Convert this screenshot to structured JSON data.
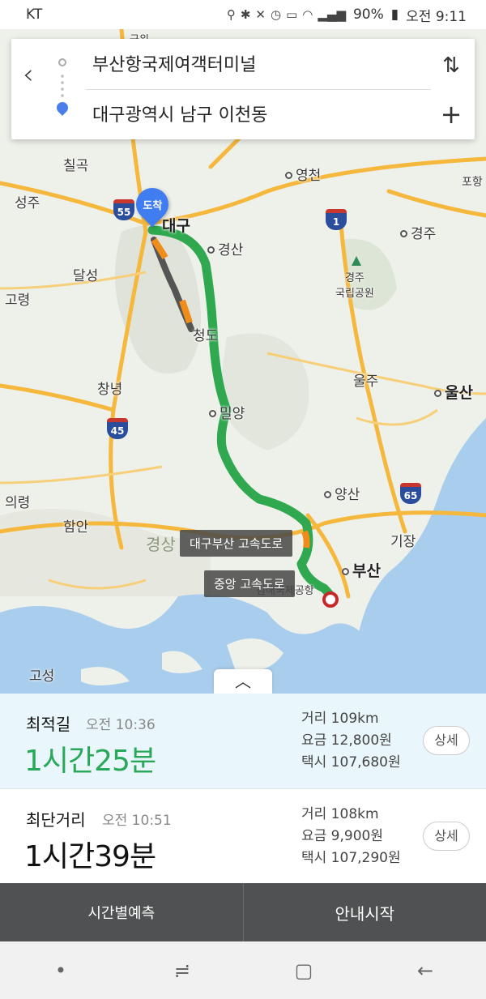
{
  "status_bar": {
    "carrier": "KT",
    "battery": "90%",
    "time": "오전 9:11"
  },
  "search": {
    "origin": "부산항국제여객터미널",
    "destination": "대구광역시 남구 이천동",
    "back_icon": "back-arrow-icon",
    "swap_icon": "swap-icon",
    "add_icon": "plus-icon"
  },
  "map": {
    "places": {
      "chilgok": "칠곡",
      "seongju": "성주",
      "daegu": "대구",
      "gyeongsan": "경산",
      "yeongcheon": "영천",
      "gyeongju": "경주",
      "gyeongju_park": "경주\n국립공원",
      "pohang": "포항",
      "dalseong": "달성",
      "goryeong": "고령",
      "cheongdo": "청도",
      "changnyeong": "창녕",
      "miryang": "밀양",
      "ulju": "울주",
      "ulsan": "울산",
      "uiryeong": "의령",
      "haman": "함안",
      "yangsan": "양산",
      "gijang": "기장",
      "busan": "부산",
      "goseong": "고성",
      "gyeongsang": "경상",
      "airport": "김해국제공항",
      "top_partial": "군위"
    },
    "shields": [
      "55",
      "1",
      "45",
      "65"
    ],
    "destination_pin": "도착",
    "road_tags": [
      "대구부산 고속도로",
      "중앙 고속도로"
    ],
    "colors": {
      "route": "#2fa84f",
      "route_slow": "#f08c1a",
      "route_jam": "#555555",
      "highway": "#f5b83d"
    }
  },
  "routes": [
    {
      "name": "최적길",
      "arrival": "오전 10:36",
      "duration": "1시간25분",
      "distance": "거리 109km",
      "toll": "요금 12,800원",
      "taxi": "택시 107,680원",
      "detail_label": "상세"
    },
    {
      "name": "최단거리",
      "arrival": "오전 10:51",
      "duration": "1시간39분",
      "distance": "거리 108km",
      "toll": "요금 9,900원",
      "taxi": "택시 107,290원",
      "detail_label": "상세"
    }
  ],
  "actions": {
    "time_forecast": "시간별예측",
    "start_guide": "안내시작"
  }
}
